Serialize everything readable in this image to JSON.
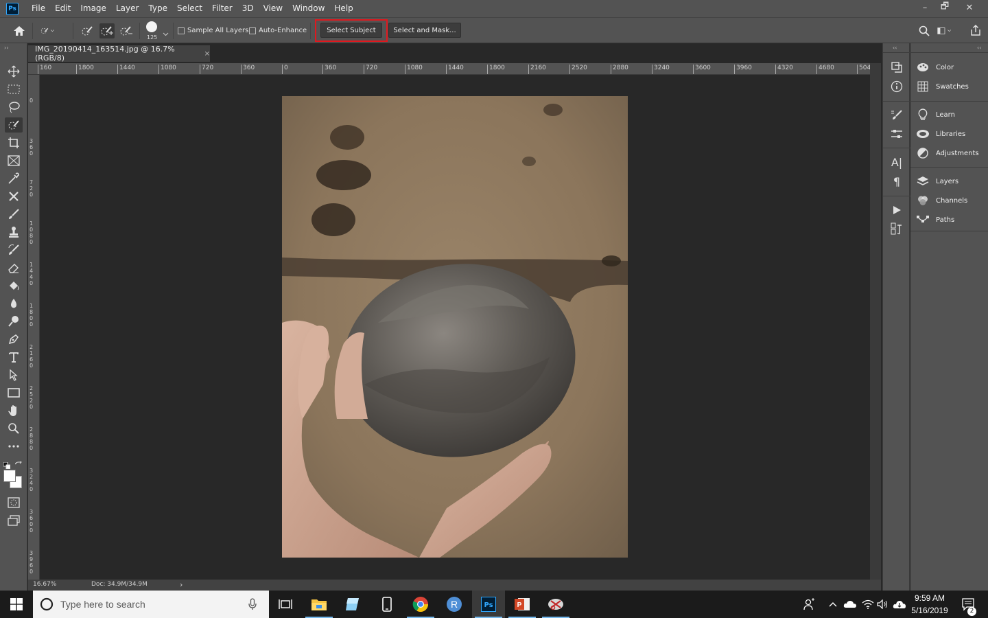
{
  "app": {
    "logo_text": "Ps",
    "accent": "#31a8ff"
  },
  "menu": [
    "File",
    "Edit",
    "Image",
    "Layer",
    "Type",
    "Select",
    "Filter",
    "3D",
    "View",
    "Window",
    "Help"
  ],
  "window_controls": {
    "minimize": "–",
    "restore": "🗗",
    "close": "✕"
  },
  "options": {
    "brush_size": "125",
    "sample_all_layers_label": "Sample All Layers",
    "auto_enhance_label": "Auto-Enhance",
    "select_subject_label": "Select Subject",
    "select_and_mask_label": "Select and Mask...",
    "highlight_color": "#e0181e"
  },
  "document": {
    "tab_title": "IMG_20190414_163514.jpg @ 16.7% (RGB/8)",
    "tab_close": "×",
    "ruler_top": [
      "160",
      "1800",
      "1440",
      "1080",
      "720",
      "360",
      "0",
      "360",
      "720",
      "1080",
      "1440",
      "1800",
      "2160",
      "2520",
      "2880",
      "3240",
      "3600",
      "3960",
      "4320",
      "4680",
      "504"
    ],
    "ruler_left": [
      "0",
      "360",
      "720",
      "1080",
      "1440",
      "1800",
      "2160",
      "2520",
      "2880",
      "3240",
      "3600",
      "3960"
    ]
  },
  "status": {
    "zoom": "16.67%",
    "doc_info": "Doc: 34.9M/34.9M",
    "arrow": "›"
  },
  "panels": [
    {
      "label": "Color",
      "icon": "color-icon"
    },
    {
      "label": "Swatches",
      "icon": "swatches-icon"
    },
    {
      "label": "Learn",
      "icon": "learn-icon"
    },
    {
      "label": "Libraries",
      "icon": "libraries-icon"
    },
    {
      "label": "Adjustments",
      "icon": "adjustments-icon"
    },
    {
      "label": "Layers",
      "icon": "layers-icon"
    },
    {
      "label": "Channels",
      "icon": "channels-icon"
    },
    {
      "label": "Paths",
      "icon": "paths-icon"
    }
  ],
  "taskbar": {
    "search_placeholder": "Type here to search",
    "time": "9:59 AM",
    "date": "5/16/2019",
    "notification_count": "2"
  }
}
